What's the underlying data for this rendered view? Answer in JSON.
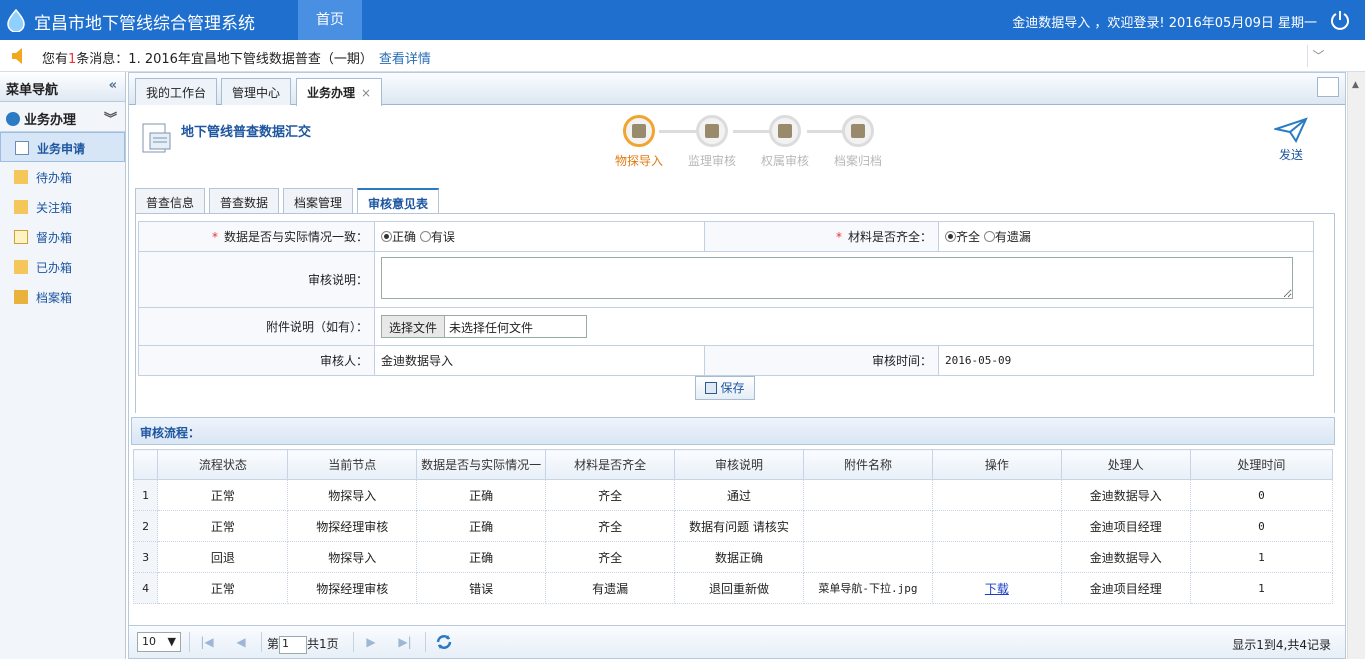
{
  "header": {
    "title": "宜昌市地下管线综合管理系统",
    "nav_home": "首页",
    "welcome": "金迪数据导入 ，欢迎登录! 2016年05月09日 星期一"
  },
  "message": {
    "prefix": "您有",
    "count": "1",
    "suffix": "条消息：1. 2016年宜昌地下管线数据普查（一期）",
    "link": "查看详情"
  },
  "sidebar": {
    "title": "菜单导航",
    "section": "业务办理",
    "items": [
      {
        "label": "业务申请",
        "icon": "doc-add-icon"
      },
      {
        "label": "待办箱",
        "icon": "folder-pencil-icon"
      },
      {
        "label": "关注箱",
        "icon": "folder-star-icon"
      },
      {
        "label": "督办箱",
        "icon": "doc-list-icon"
      },
      {
        "label": "已办箱",
        "icon": "folder-check-icon"
      },
      {
        "label": "档案箱",
        "icon": "archive-icon"
      }
    ]
  },
  "tabs": [
    {
      "label": "我的工作台"
    },
    {
      "label": "管理中心"
    },
    {
      "label": "业务办理",
      "close": "×"
    }
  ],
  "doc": {
    "title": "地下管线普查数据汇交"
  },
  "steps": [
    {
      "label": "物探导入",
      "active": true
    },
    {
      "label": "监理审核",
      "active": false
    },
    {
      "label": "权属审核",
      "active": false
    },
    {
      "label": "档案归档",
      "active": false
    }
  ],
  "send_label": "发送",
  "subtabs": [
    "普查信息",
    "普查数据",
    "档案管理",
    "审核意见表"
  ],
  "form": {
    "q1_label": "数据是否与实际情况一致：",
    "q1_opt1": "正确",
    "q1_opt2": "有误",
    "q2_label": "材料是否齐全：",
    "q2_opt1": "齐全",
    "q2_opt2": "有遗漏",
    "remark_label": "审核说明：",
    "attach_label": "附件说明（如有）：",
    "file_button": "选择文件",
    "file_status": "未选择任何文件",
    "reviewer_label": "审核人：",
    "reviewer": "金迪数据导入",
    "time_label": "审核时间：",
    "time": "2016-05-09",
    "save": "保存"
  },
  "flow": {
    "title": "审核流程：",
    "columns": [
      "流程状态",
      "当前节点",
      "数据是否与实际情况一",
      "材料是否齐全",
      "审核说明",
      "附件名称",
      "操作",
      "处理人",
      "处理时间"
    ],
    "rows": [
      {
        "n": "1",
        "status": "正常",
        "node": "物探导入",
        "data_ok": "正确",
        "complete": "齐全",
        "remark": "通过",
        "attach": "",
        "op": "",
        "handler": "金迪数据导入",
        "time": "0"
      },
      {
        "n": "2",
        "status": "正常",
        "node": "物探经理审核",
        "data_ok": "正确",
        "complete": "齐全",
        "remark": "数据有问题 请核实",
        "attach": "",
        "op": "",
        "handler": "金迪项目经理",
        "time": "0"
      },
      {
        "n": "3",
        "status": "回退",
        "node": "物探导入",
        "data_ok": "正确",
        "complete": "齐全",
        "remark": "数据正确",
        "attach": "",
        "op": "",
        "handler": "金迪数据导入",
        "time": "1"
      },
      {
        "n": "4",
        "status": "正常",
        "node": "物探经理审核",
        "data_ok": "错误",
        "complete": "有遗漏",
        "remark": "退回重新做",
        "attach": "菜单导航-下拉.jpg",
        "op": "下载",
        "handler": "金迪项目经理",
        "time": "1"
      }
    ]
  },
  "pager": {
    "size": "10",
    "page_prefix": "第",
    "page": "1",
    "page_suffix": "共1页",
    "summary": "显示1到4,共4记录"
  }
}
